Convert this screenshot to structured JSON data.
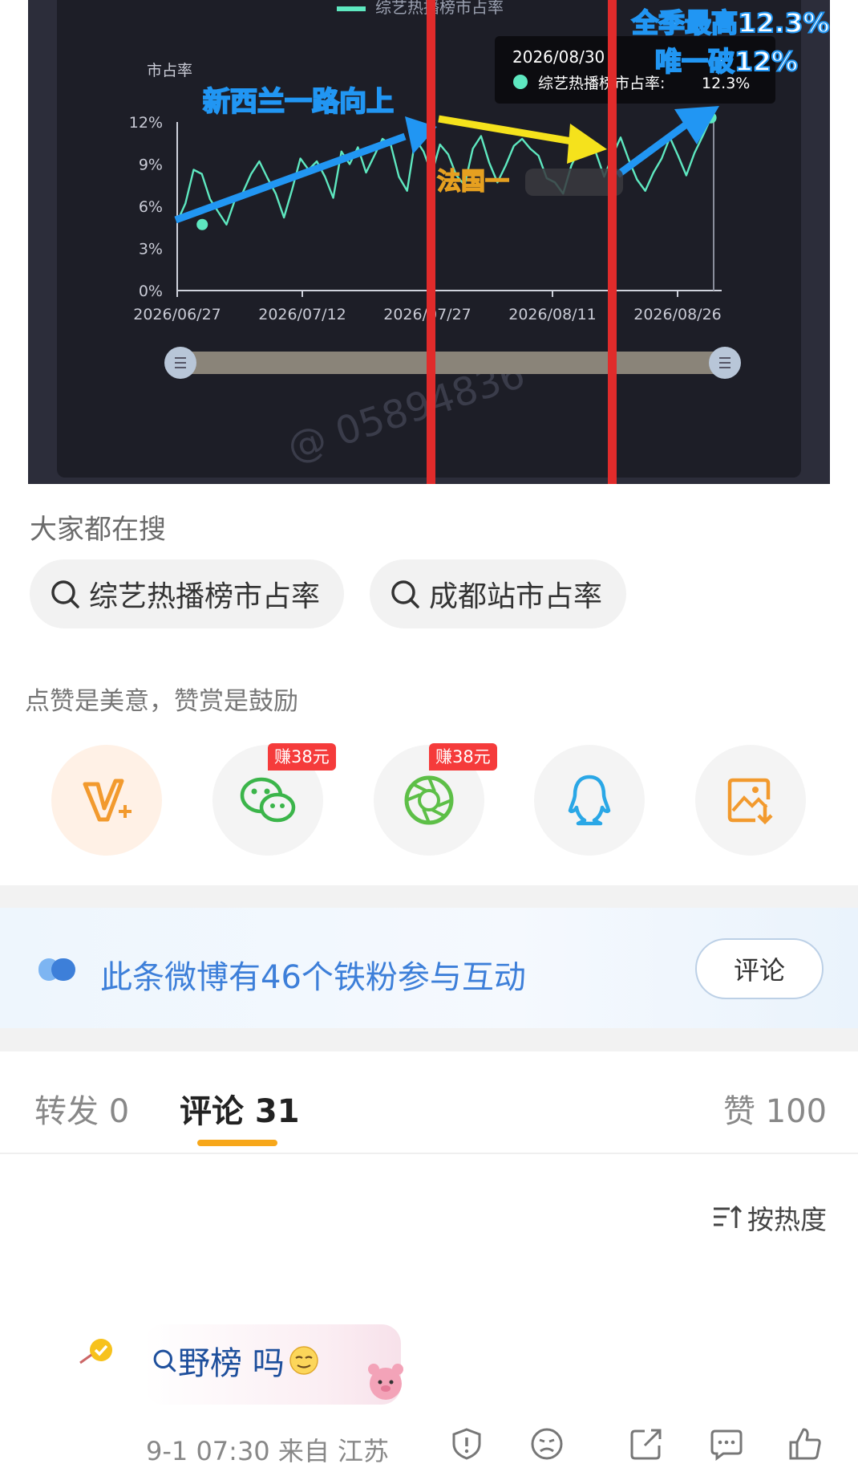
{
  "chart": {
    "title": "综艺热播榜市占率",
    "ylabel": "市占率",
    "tooltip": {
      "date": "2026/08/30",
      "series": "综艺热播榜市占率:",
      "value": "12.3%"
    },
    "annotations": {
      "rise": "新西兰一路向上",
      "france": "法国一",
      "peak": "全季最高12.3%",
      "break": "唯一破12%"
    },
    "watermark": "@ 05894836",
    "colors": {
      "line": "#5ee8c0",
      "blue_arrow": "#2196f3",
      "yellow_arrow": "#f5e21c",
      "red_line": "#e02b2b"
    }
  },
  "chart_data": {
    "type": "line",
    "title": "综艺热播榜市占率",
    "ylabel": "市占率",
    "y_ticks": [
      "0%",
      "3%",
      "6%",
      "9%",
      "12%"
    ],
    "ylim": [
      0,
      12
    ],
    "x_ticks": [
      "2026/06/27",
      "2026/07/12",
      "2026/07/27",
      "2026/08/11",
      "2026/08/26"
    ],
    "x_range": [
      "2026/06/27",
      "2026/08/30"
    ],
    "series": [
      {
        "name": "综艺热播榜市占率",
        "values": [
          4.9,
          6.2,
          8.6,
          8.3,
          6.5,
          5.6,
          4.7,
          6.4,
          7.0,
          8.3,
          9.2,
          8.0,
          6.9,
          5.2,
          7.2,
          9.4,
          8.6,
          9.2,
          8.1,
          6.6,
          9.9,
          9.0,
          10.2,
          8.4,
          9.6,
          10.8,
          10.4,
          8.1,
          7.1,
          10.8,
          9.9,
          8.3,
          10.4,
          9.7,
          8.2,
          7.5,
          10.1,
          11.0,
          9.1,
          7.7,
          8.9,
          10.3,
          10.8,
          10.1,
          9.6,
          8.0,
          7.7,
          6.9,
          8.9,
          10.1,
          10.7,
          9.8,
          8.1,
          9.6,
          10.9,
          9.3,
          7.9,
          7.1,
          8.4,
          9.4,
          10.9,
          9.6,
          8.2,
          9.8,
          11.0,
          12.3
        ],
        "highlighted": [
          {
            "x": "2026/06/30",
            "y": 4.7
          },
          {
            "x": "2026/08/30",
            "y": 12.3
          }
        ]
      }
    ],
    "grid": false,
    "legend": "top"
  },
  "search": {
    "title": "大家都在搜",
    "chips": [
      "综艺热播榜市占率",
      "成都站市占率"
    ]
  },
  "reward": {
    "text": "点赞是美意，赞赏是鼓励"
  },
  "share": {
    "badge": "赚38元",
    "icons": [
      "v-plus-icon",
      "wechat-icon",
      "moments-icon",
      "qq-icon",
      "save-image-icon"
    ]
  },
  "fans": {
    "text": "此条微博有46个铁粉参与互动",
    "button": "评论"
  },
  "tabs": {
    "repost": "转发 0",
    "comment": "评论 31",
    "like": "赞 100"
  },
  "sort": {
    "label": "按热度"
  },
  "comment": {
    "text": "野榜 吗",
    "meta": "9-1 07:30 来自 江苏"
  }
}
